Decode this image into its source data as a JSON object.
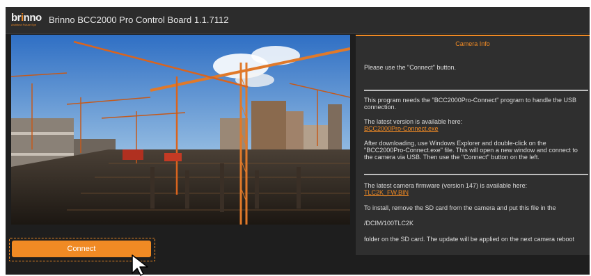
{
  "app": {
    "logo": {
      "word_a": "br",
      "word_b": "i",
      "word_c": "nno",
      "tagline": "Architect Future Eye"
    },
    "title": "Brinno BCC2000 Pro Control Board 1.1.7112"
  },
  "photo": {
    "subject": "construction site with tower cranes"
  },
  "actions": {
    "connect_label": "Connect"
  },
  "camera_info": {
    "header": "Camera Info",
    "prompt": "Please use the \"Connect\" button.",
    "needs_program": "This program needs the \"BCC2000Pro-Connect\" program to handle the USB connection.",
    "latest_version": "The latest version is available here:",
    "connect_exe_link": "BCC2000Pro-Connect.exe",
    "after_download": "After downloading, use Windows Explorer and double-click on the \"BCC2000Pro-Connect.exe\" file. This will open a new window and connect to the camera via USB. Then use the \"Connect\" button on the left.",
    "firmware_text": "The latest camera firmware (version 147) is available here:",
    "firmware_link": "TLC2K_FW.BIN",
    "install_text": "To install, remove the SD card from the camera and put this file in the",
    "folder_path": "/DCIM/100TLC2K",
    "folder_text": "folder on the SD card. The update will be applied on the next camera reboot"
  },
  "colors": {
    "accent": "#f08a24",
    "background": "#1e1e1e",
    "panel": "#2f2f2f",
    "text": "#dcdcdc"
  },
  "icons": {
    "cursor": "mouse-pointer-icon",
    "logo": "brinno-logo-icon"
  }
}
